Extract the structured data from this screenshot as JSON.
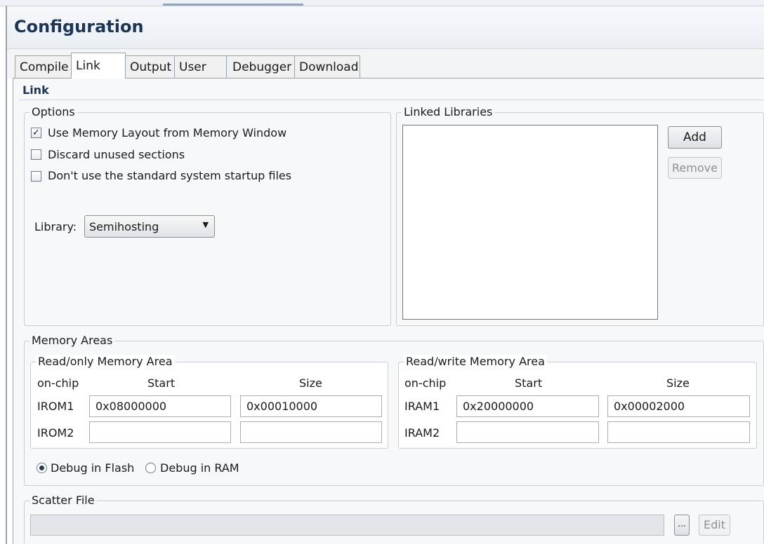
{
  "header": {
    "title": "Configuration"
  },
  "tabs": [
    {
      "label": "Compile",
      "active": false
    },
    {
      "label": "Link",
      "active": true
    },
    {
      "label": "Output",
      "active": false
    },
    {
      "label": "User",
      "active": false
    },
    {
      "label": "Debugger",
      "active": false
    },
    {
      "label": "Download",
      "active": false
    }
  ],
  "section": {
    "title": "Link"
  },
  "options": {
    "legend": "Options",
    "use_memory_layout": {
      "label": "Use Memory Layout from Memory Window",
      "checked": true
    },
    "discard_unused": {
      "label": "Discard unused sections",
      "checked": false
    },
    "no_startup_files": {
      "label": "Don't use the standard system startup files",
      "checked": false
    },
    "library": {
      "label": "Library:",
      "value": "Semihosting"
    }
  },
  "linked_libraries": {
    "legend": "Linked Libraries",
    "add_label": "Add",
    "remove_label": "Remove"
  },
  "memory_areas": {
    "legend": "Memory Areas",
    "readonly": {
      "legend": "Read/only Memory Area",
      "col_onchip": "on-chip",
      "col_start": "Start",
      "col_size": "Size",
      "rows": [
        {
          "name": "IROM1",
          "start": "0x08000000",
          "size": "0x00010000"
        },
        {
          "name": "IROM2",
          "start": "",
          "size": ""
        }
      ]
    },
    "readwrite": {
      "legend": "Read/write Memory Area",
      "col_onchip": "on-chip",
      "col_start": "Start",
      "col_size": "Size",
      "rows": [
        {
          "name": "IRAM1",
          "start": "0x20000000",
          "size": "0x00002000"
        },
        {
          "name": "IRAM2",
          "start": "",
          "size": ""
        }
      ]
    },
    "debug_flash": {
      "label": "Debug in Flash",
      "selected": true
    },
    "debug_ram": {
      "label": "Debug in RAM",
      "selected": false
    }
  },
  "scatter": {
    "legend": "Scatter File",
    "value": "",
    "browse_label": "...",
    "edit_label": "Edit"
  }
}
